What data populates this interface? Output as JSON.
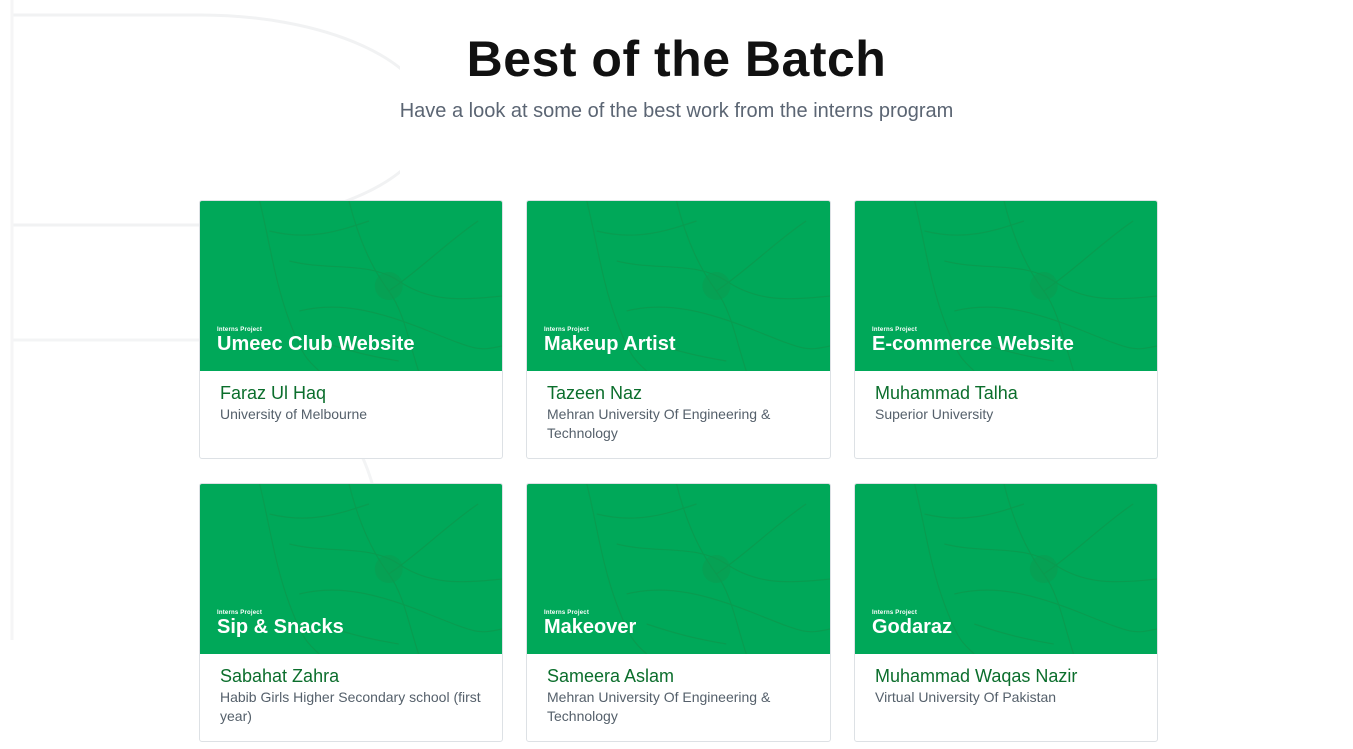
{
  "section": {
    "title": "Best of the Batch",
    "subtitle": "Have a look at some of the best work from the interns program"
  },
  "colors": {
    "card_green": "#00a859",
    "name_green": "#0b6e2c",
    "text_gray": "#55606b"
  },
  "cards": [
    {
      "tag": "Interns Project",
      "project": "Umeec Club Website",
      "name": "Faraz Ul Haq",
      "school": "University of Melbourne"
    },
    {
      "tag": "Interns Project",
      "project": "Makeup Artist",
      "name": "Tazeen Naz",
      "school": "Mehran University Of Engineering & Technology"
    },
    {
      "tag": "Interns Project",
      "project": "E-commerce Website",
      "name": "Muhammad Talha",
      "school": "Superior University"
    },
    {
      "tag": "Interns Project",
      "project": "Sip & Snacks",
      "name": "Sabahat Zahra",
      "school": "Habib Girls Higher Secondary school (first year)"
    },
    {
      "tag": "Interns Project",
      "project": "Makeover",
      "name": "Sameera Aslam",
      "school": "Mehran University Of Engineering & Technology"
    },
    {
      "tag": "Interns Project",
      "project": "Godaraz",
      "name": "Muhammad Waqas Nazir",
      "school": "Virtual University Of Pakistan"
    }
  ]
}
